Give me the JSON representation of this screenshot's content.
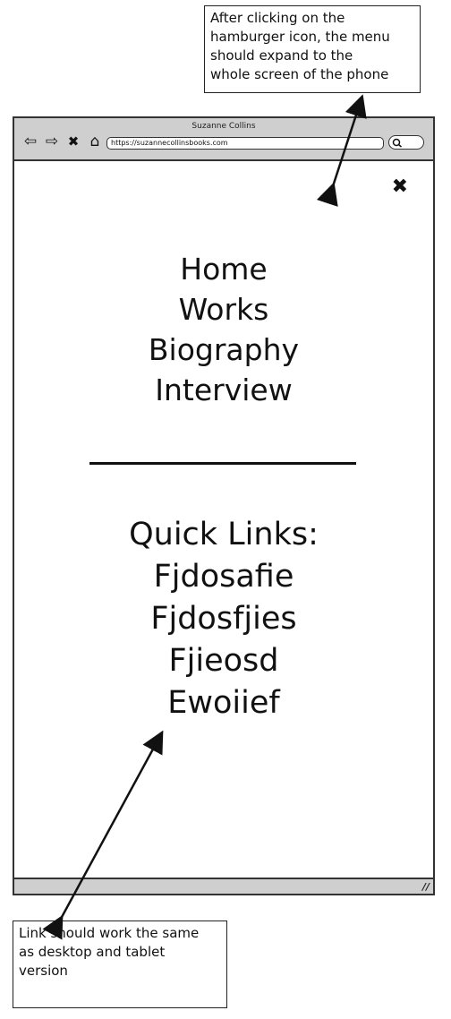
{
  "annotations": {
    "top_note": [
      "After clicking on the",
      "hamburger icon, the menu",
      "should expand to the",
      "whole screen of the phone"
    ],
    "bottom_note": [
      "Link should work the same",
      "as desktop and tablet",
      "version"
    ]
  },
  "browser": {
    "title": "Suzanne Collins",
    "url": "https://suzannecollinsbooks.com",
    "nav_icons": [
      "back-arrow-icon",
      "forward-arrow-icon",
      "close-x-icon",
      "home-icon"
    ],
    "search_icon": "search-icon"
  },
  "menu": {
    "close_label": "✖",
    "items": [
      "Home",
      "Works",
      "Biography",
      "Interview"
    ]
  },
  "quick_links": {
    "title": "Quick Links:",
    "links": [
      "Fjdosafie",
      "Fjdosfjies",
      "Fjieosd",
      "Ewoiief"
    ]
  },
  "colors": {
    "chrome": "#cfcfcf",
    "ink": "#111111",
    "background": "#ffffff"
  }
}
